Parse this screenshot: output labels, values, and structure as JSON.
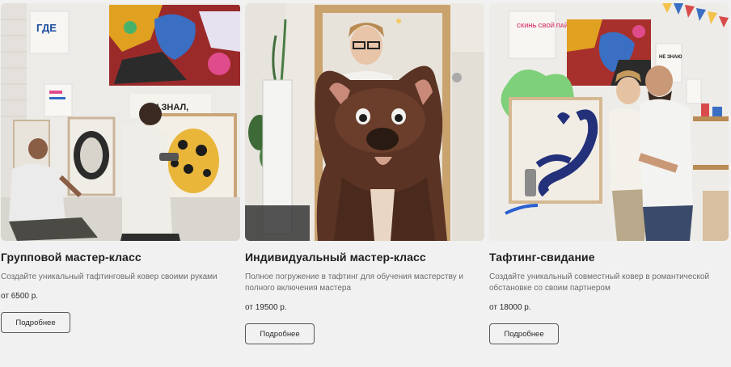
{
  "cards": [
    {
      "title": "Групповой мастер-класс",
      "description": "Создайте уникальный тафтинговый ковер своими руками",
      "price": "от 6500 р.",
      "button_label": "Подробнее",
      "photo_signs": [
        "ГДЕ",
        "ТЫ ЗНАЛ,"
      ]
    },
    {
      "title": "Индивидуальный мастер-класс",
      "description": "Полное погружение в тафтинг для обучения мастерству и полного включения мастера",
      "price": "от 19500 р.",
      "button_label": "Подробнее"
    },
    {
      "title": "Тафтинг-свидание",
      "description": "Создайте уникальный совместный ковер в романтической обстановке со своим партнером",
      "price": "от 18000 р.",
      "button_label": "Подробнее",
      "photo_signs": [
        "СКИНЬ СВОЙ ПАЙФАСТ",
        "НЕ ЗНАЮ"
      ]
    }
  ]
}
